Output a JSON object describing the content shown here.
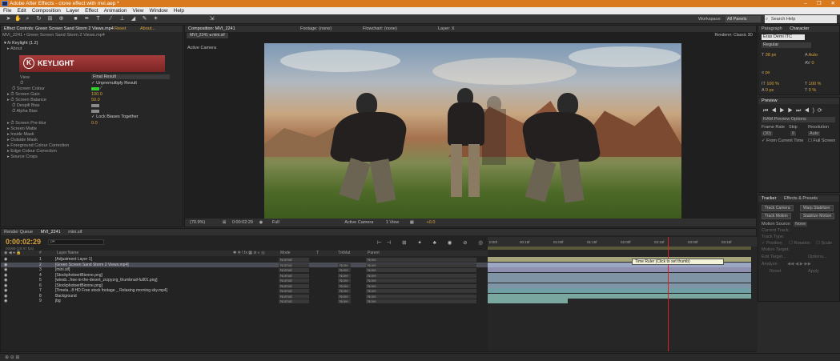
{
  "window": {
    "title": "Adobe After Effects - clone effect with mvi.aep *",
    "controls": [
      "–",
      "❐",
      "✕"
    ]
  },
  "menu": [
    "File",
    "Edit",
    "Composition",
    "Layer",
    "Effect",
    "Animation",
    "View",
    "Window",
    "Help"
  ],
  "toolbar": {
    "workspace_label": "Workspace:",
    "workspace_value": "All Panels",
    "search_placeholder": "Search Help"
  },
  "effect_controls": {
    "tab": "Effect Controls: Green Screen Sand Storm 2 Views.mp4",
    "tab_reset": "Reset",
    "tab_about": "About...",
    "subtitle": "MVI_2241 • Green Screen Sand Storm 2 Views.mp4",
    "effect_name": "Keylight (1.2)",
    "about_row": "About",
    "logo_text": "KEYLIGHT",
    "rows": [
      {
        "label": "View",
        "value": "Final Result"
      },
      {
        "label": "",
        "value": "Unpremultiply Result"
      },
      {
        "label": "Screen Colour",
        "value": ""
      },
      {
        "label": "Screen Gain",
        "value": "100.0"
      },
      {
        "label": "Screen Balance",
        "value": "50.0"
      },
      {
        "label": "Despill Bias",
        "value": ""
      },
      {
        "label": "Alpha Bias",
        "value": ""
      },
      {
        "label": "",
        "value": "Lock Biases Together"
      },
      {
        "label": "Screen Pre-blur",
        "value": "0.0"
      },
      {
        "label": "Screen Matte",
        "value": ""
      },
      {
        "label": "Inside Mask",
        "value": ""
      },
      {
        "label": "Outside Mask",
        "value": ""
      },
      {
        "label": "Foreground Colour Correction",
        "value": ""
      },
      {
        "label": "Edge Colour Correction",
        "value": ""
      },
      {
        "label": "Source Crops",
        "value": ""
      }
    ],
    "screen_colour": "#33cc33"
  },
  "composition": {
    "tabs": [
      "Composition: MVI_2241",
      "Footage: (none)",
      "Flowchart: (none)",
      "Layer: X"
    ],
    "sub_tabs": [
      "MVI_2241",
      "mini.sif"
    ],
    "renderer": "Renderer: Classic 3D",
    "active_camera": "Active Camera",
    "footer": {
      "zoom": "(70.9%)",
      "timecode": "0:00:02:29",
      "resolution": "Full",
      "camera": "Active Camera",
      "views": "1 View",
      "exposure": "+0.0"
    }
  },
  "character": {
    "tabs": [
      "Paragraph",
      "Character"
    ],
    "font": "Eras Demi ITC",
    "style": "Regular",
    "size": "38 px",
    "leading": "Auto",
    "tracking": "0",
    "vscale": "100 %",
    "hscale": "100 %",
    "baseline": "0 px",
    "tsume": "0 %",
    "stroke": "px"
  },
  "preview": {
    "tab": "Preview",
    "ram_options": "RAM Preview Options",
    "frame_rate_label": "Frame Rate",
    "skip_label": "Skip",
    "resolution_label": "Resolution",
    "frame_rate_value": "(30)",
    "skip_value": "0",
    "resolution_value": "Auto",
    "from_current": "From Current Time",
    "full_screen": "Full Screen"
  },
  "tracker": {
    "tabs": [
      "Tracker",
      "Effects & Presets"
    ],
    "buttons": [
      "Track Camera",
      "Warp Stabilizer",
      "Track Motion",
      "Stabilize Motion"
    ],
    "motion_source_label": "Motion Source:",
    "motion_source_value": "None",
    "current_track": "Current Track:",
    "track_type": "Track Type:",
    "position": "Position",
    "rotation": "Rotation",
    "scale": "Scale",
    "motion_target": "Motion Target:",
    "edit_target": "Edit Target...",
    "options": "Options...",
    "analyze": "Analyze:",
    "reset": "Reset",
    "apply": "Apply"
  },
  "timeline": {
    "tabs": [
      "Render Queue",
      "MVI_2241",
      "mini.sif"
    ],
    "timecode": "0:00:02:29",
    "fps": "00089 (29.97 fps)",
    "search_placeholder": "ρ▾",
    "columns": [
      "#",
      "Layer Name",
      "Mode",
      "T",
      "TrkMat",
      "Parent"
    ],
    "ruler_ticks": [
      "0:00f",
      "00:15f",
      "01:00f",
      "01:15f",
      "02:00f",
      "02:15f",
      "03:00f",
      "03:15f"
    ],
    "tooltip": "Time Ruler (Click to set thumb)",
    "layers": [
      {
        "num": "1",
        "name": "[Adjustment Layer 1]",
        "mode": "Normal",
        "trkmat": "",
        "parent": "None",
        "selected": false
      },
      {
        "num": "2",
        "name": "[Green Screen Sand Storm 2 Views.mp4]",
        "mode": "Normal",
        "trkmat": "None",
        "parent": "None",
        "selected": true
      },
      {
        "num": "3",
        "name": "[mini.sif]",
        "mode": "Normal",
        "trkmat": "None",
        "parent": "None",
        "selected": false
      },
      {
        "num": "4",
        "name": "[StockphotoertBionne.png]",
        "mode": "Normal",
        "trkmat": "None",
        "parent": "None",
        "selected": false
      },
      {
        "num": "5",
        "name": "[wiesb...free-in-the-desert_zrzpyzrg_thumbnail-full01.png]",
        "mode": "Normal",
        "trkmat": "None",
        "parent": "None",
        "selected": false
      },
      {
        "num": "6",
        "name": "[StockphotoertBionne.png]",
        "mode": "Normal",
        "trkmat": "None",
        "parent": "None",
        "selected": false
      },
      {
        "num": "7",
        "name": "[Timela...8 HD Free stock footage _ Relaxing morning sky.mp4]",
        "mode": "Normal",
        "trkmat": "None",
        "parent": "None",
        "selected": false
      },
      {
        "num": "8",
        "name": "Background",
        "mode": "Normal",
        "trkmat": "None",
        "parent": "None",
        "selected": false
      },
      {
        "num": "9",
        "name": "jbg",
        "mode": "Normal",
        "trkmat": "None",
        "parent": "None",
        "selected": false
      }
    ]
  }
}
